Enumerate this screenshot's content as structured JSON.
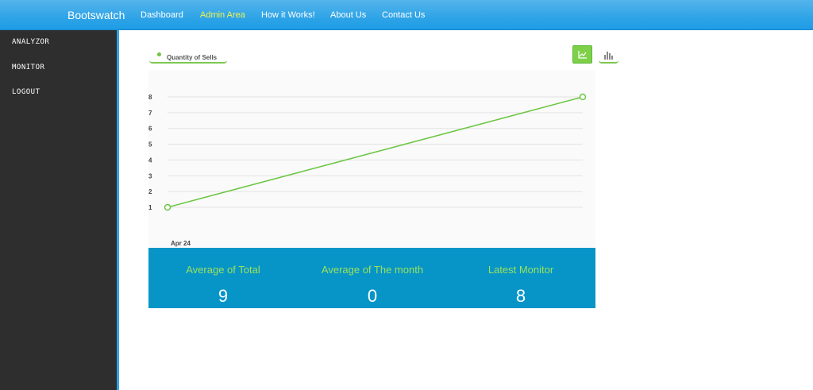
{
  "navbar": {
    "brand": "Bootswatch",
    "links": [
      {
        "label": "Dashboard",
        "active": false
      },
      {
        "label": "Admin Area",
        "active": true
      },
      {
        "label": "How it Works!",
        "active": false
      },
      {
        "label": "About Us",
        "active": false
      },
      {
        "label": "Contact Us",
        "active": false
      }
    ]
  },
  "sidebar": {
    "items": [
      {
        "label": "ANALYZOR"
      },
      {
        "label": "MONITOR"
      },
      {
        "label": "LOGOUT"
      }
    ]
  },
  "chart_toolbar": {
    "line_icon": "line-chart-icon",
    "bar_icon": "bar-chart-icon",
    "active": "line"
  },
  "chart_data": {
    "type": "line",
    "title": "",
    "xlabel": "",
    "ylabel": "",
    "legend": "top-left",
    "grid": true,
    "x_tick_labels": [
      "Apr 24"
    ],
    "y_ticks": [
      1,
      2,
      3,
      4,
      5,
      6,
      7,
      8
    ],
    "ylim": [
      1,
      8
    ],
    "series": [
      {
        "name": "Quantity of Sells",
        "color": "#6cc644",
        "points": [
          1,
          8
        ]
      }
    ]
  },
  "stats": [
    {
      "label": "Average of Total",
      "value": "9"
    },
    {
      "label": "Average of The month",
      "value": "0"
    },
    {
      "label": "Latest Monitor",
      "value": "8"
    }
  ],
  "colors": {
    "navbar": "#2fa4e7",
    "active_link": "#f3f34b",
    "sidebar": "#2e2e2e",
    "accent_green": "#6cc644",
    "stats_bg": "#0795c8",
    "stats_label": "#9be25a"
  }
}
